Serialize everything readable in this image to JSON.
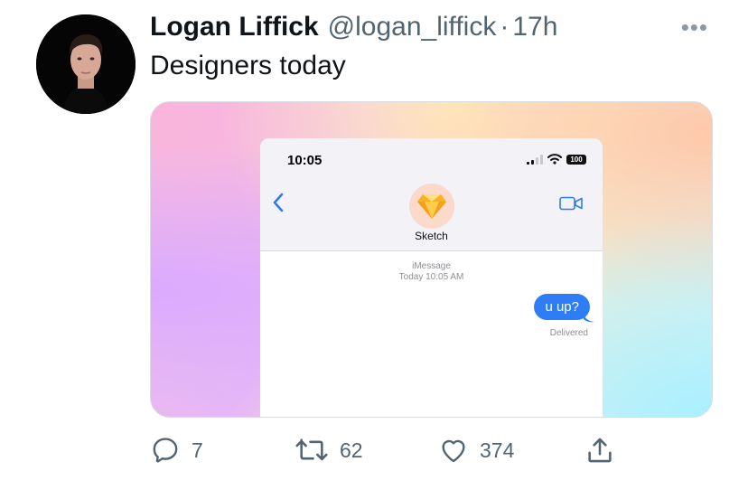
{
  "tweet": {
    "display_name": "Logan Liffick",
    "handle": "@logan_liffick",
    "separator": "·",
    "time": "17h",
    "more_label": "•••",
    "text": "Designers today"
  },
  "media": {
    "phone": {
      "clock": "10:05",
      "battery": "100",
      "contact_name": "Sketch",
      "service_label": "iMessage",
      "timestamp": "Today 10:05 AM",
      "message": "u up?",
      "status": "Delivered"
    }
  },
  "actions": {
    "reply_count": "7",
    "retweet_count": "62",
    "like_count": "374"
  },
  "colors": {
    "text_primary": "#0f1419",
    "text_secondary": "#536471",
    "imessage_blue": "#2f7df6",
    "ios_blue": "#2f7df6"
  },
  "icons": [
    "more-icon",
    "reply-icon",
    "retweet-icon",
    "like-icon",
    "share-icon",
    "back-chevron-icon",
    "video-call-icon",
    "sketch-diamond-icon",
    "signal-icon",
    "wifi-icon",
    "battery-icon"
  ]
}
